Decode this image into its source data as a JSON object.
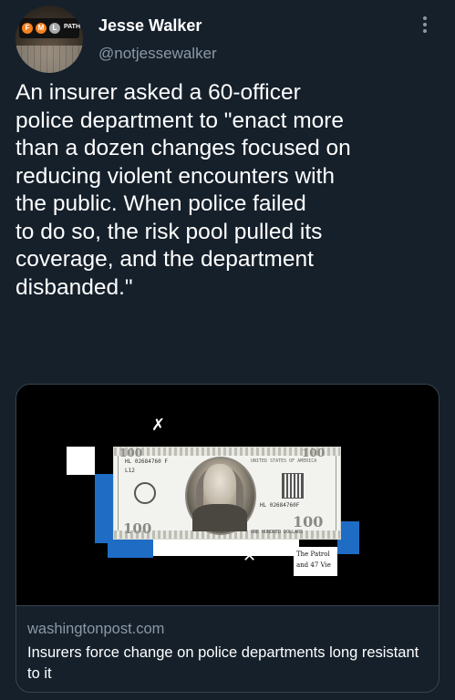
{
  "author": {
    "display_name": "Jesse Walker",
    "handle": "@notjessewalker",
    "avatar_sign_letters": [
      "F",
      "M",
      "L"
    ],
    "avatar_sign_path": "PATH"
  },
  "tweet": {
    "text": "An insurer asked a 60-officer\npolice department to \"enact more\nthan a dozen changes focused on\nreducing violent encounters with\nthe public. When police failed\nto do so, the risk pool pulled its\ncoverage, and the department\ndisbanded.\""
  },
  "card": {
    "domain": "washingtonpost.com",
    "title": "Insurers force change on police departments long resistant to it",
    "image": {
      "bill": {
        "serial_left": "HL 02684760 F",
        "serial_right": "HL 02684760F",
        "code": "L12",
        "top_banner": "THE UNITED STATES OF AMERICA",
        "right_banner": "UNITED STATES OF AMERICA",
        "bottom_banner": "ONE HUNDRED DOLLARS",
        "denomination": "100"
      },
      "receipt_text": [
        "The Patrol",
        "and 47 Vie"
      ]
    }
  },
  "colors": {
    "background": "#15202b",
    "text_secondary": "#8b98a5",
    "border": "#38444d",
    "blue_block": "#1e6cc4",
    "sign_f": "#f4811f",
    "sign_m": "#f4811f",
    "sign_l": "#a7a9ac"
  },
  "icons": {
    "more": "more-vertical-icon"
  }
}
